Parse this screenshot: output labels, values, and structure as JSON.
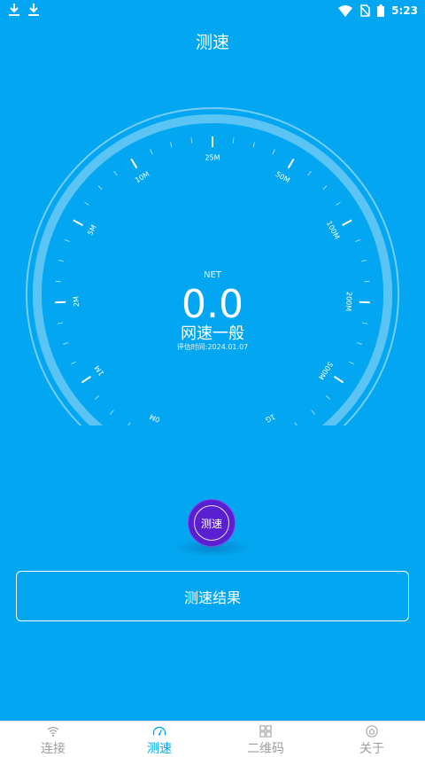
{
  "status_bar": {
    "time": "5:23"
  },
  "page": {
    "title": "测速"
  },
  "gauge": {
    "top_label": "NET",
    "speed_value": "0.0",
    "status_text": "网速一般",
    "evaluation": "评估时间:2024.01.07",
    "scale_labels": [
      "0M",
      "1M",
      "2M",
      "5M",
      "10M",
      "25M",
      "50M",
      "100M",
      "200M",
      "500M",
      "1G"
    ],
    "progress_fraction": 0
  },
  "buttons": {
    "test_label": "测速",
    "result_label": "测速结果"
  },
  "nav": {
    "items": [
      {
        "label": "连接",
        "icon": "wifi-icon",
        "active": false
      },
      {
        "label": "测速",
        "icon": "speedometer-icon",
        "active": true
      },
      {
        "label": "二维码",
        "icon": "qr-grid-icon",
        "active": false
      },
      {
        "label": "关于",
        "icon": "home-circle-icon",
        "active": false
      }
    ]
  },
  "colors": {
    "background": "#03a6f0",
    "button": "#5a1fd1",
    "nav_active": "#03a6f0",
    "nav_inactive": "#9e9e9e"
  }
}
